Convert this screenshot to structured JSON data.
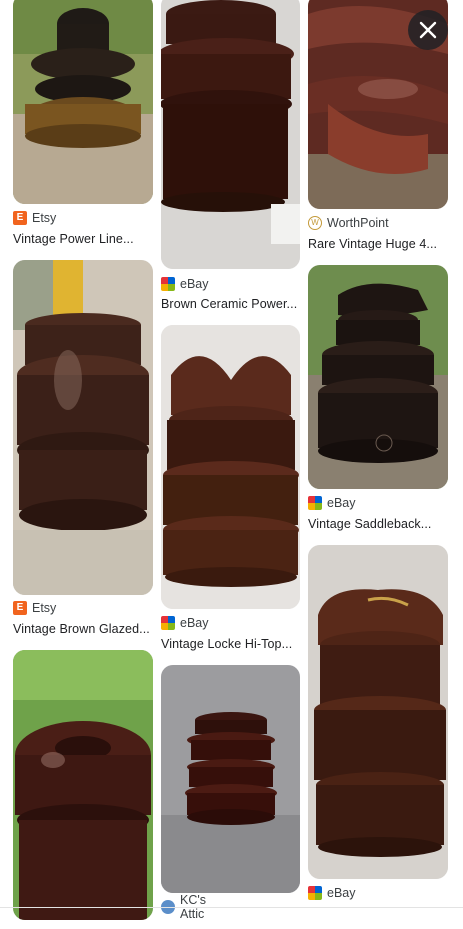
{
  "results": {
    "col1": [
      {
        "source": "Etsy",
        "favicon": "etsy-icon",
        "title": "Vintage Power Line..."
      },
      {
        "source": "Etsy",
        "favicon": "etsy-icon",
        "title": "Vintage Brown Glazed..."
      },
      {
        "source": "",
        "favicon": "",
        "title": ""
      }
    ],
    "col2": [
      {
        "source": "eBay",
        "favicon": "ebay-icon",
        "title": "Brown Ceramic Power..."
      },
      {
        "source": "eBay",
        "favicon": "ebay-icon",
        "title": "Vintage Locke Hi-Top..."
      },
      {
        "source": "KC's Attic",
        "favicon": "kcs-attic-icon",
        "title": ""
      }
    ],
    "col3": [
      {
        "source": "WorthPoint",
        "favicon": "worthpoint-icon",
        "title": "Rare Vintage Huge 4..."
      },
      {
        "source": "eBay",
        "favicon": "ebay-icon",
        "title": "Vintage Saddleback..."
      },
      {
        "source": "eBay",
        "favicon": "ebay-icon",
        "title": ""
      }
    ]
  },
  "overlay": {
    "close_icon": "close-icon"
  },
  "colors": {
    "etsy": "#f1641e",
    "ebay_red": "#e53238",
    "ebay_blue": "#0064d2",
    "ebay_yellow": "#f5af02",
    "ebay_green": "#86b817",
    "close_bg": "#202124"
  }
}
